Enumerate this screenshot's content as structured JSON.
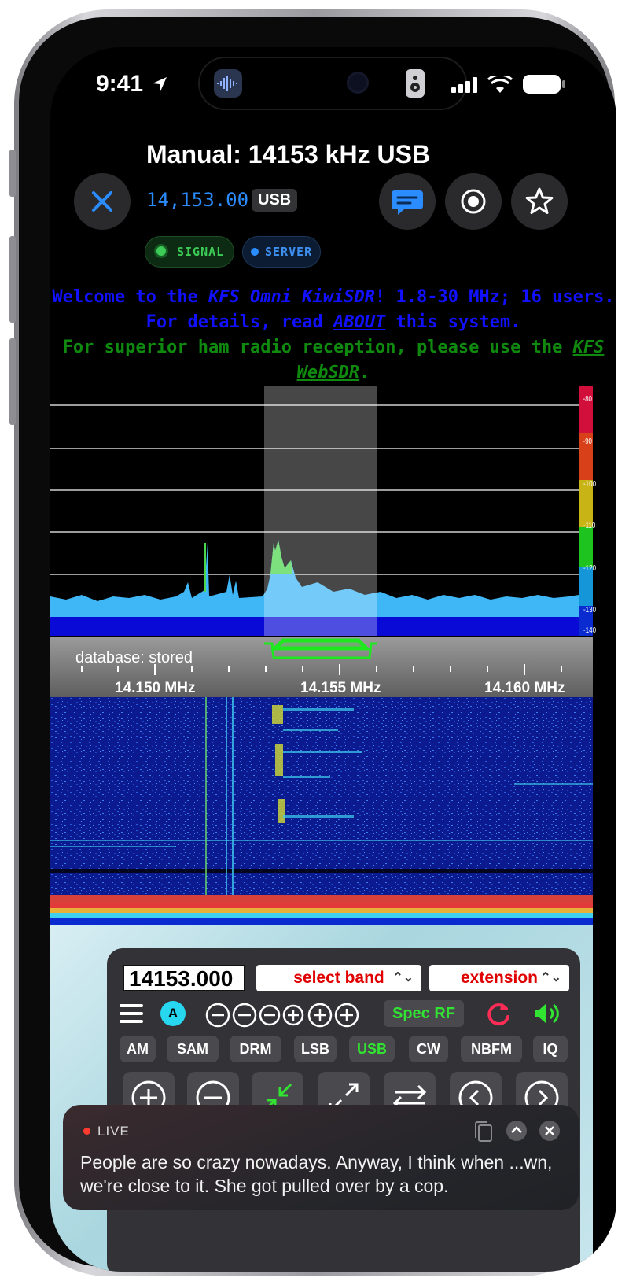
{
  "status_bar": {
    "time": "9:41"
  },
  "header": {
    "title": "Manual: 14153 kHz USB",
    "frequency": "14,153.00",
    "mode": "USB",
    "pills": {
      "signal": "SIGNAL",
      "server": "SERVER"
    }
  },
  "welcome": {
    "l1_a": "Welcome to the ",
    "l1_b": "KFS Omni KiwiSDR",
    "l1_c": "! 1.8-30 MHz; 16 users.",
    "l2_a": "For details, read ",
    "l2_b": "ABOUT",
    "l2_c": " this system.",
    "l3_a": "For superior ham radio reception, please use the ",
    "l3_b": "KFS",
    "l4_b": "WebSDR",
    "l4_c": "."
  },
  "spectrum": {
    "scale": [
      "-80",
      "-90",
      "-100",
      "-110",
      "-120",
      "-130",
      "-140"
    ]
  },
  "db_strip": {
    "label": "database: stored",
    "ticks": [
      "14.150 MHz",
      "14.155 MHz",
      "14.160 MHz"
    ]
  },
  "controls": {
    "frequency_input": "14153.000",
    "select_band": "select band",
    "extension": "extension",
    "a_badge": "A",
    "spec_rf": "Spec RF",
    "modes": [
      "AM",
      "SAM",
      "DRM",
      "LSB",
      "USB",
      "CW",
      "NBFM",
      "IQ"
    ],
    "active_mode": "USB"
  },
  "live_caption": {
    "label": "LIVE",
    "text": "People are so crazy nowadays. Anyway, I think when ...wn, we're close to it. She got pulled over by a cop."
  },
  "colors": {
    "accent_blue": "#2a8cff",
    "signal_green": "#3ccb56",
    "spec_green": "#32e432",
    "band_red": "#e00000",
    "refresh_pink": "#ff2d55"
  }
}
